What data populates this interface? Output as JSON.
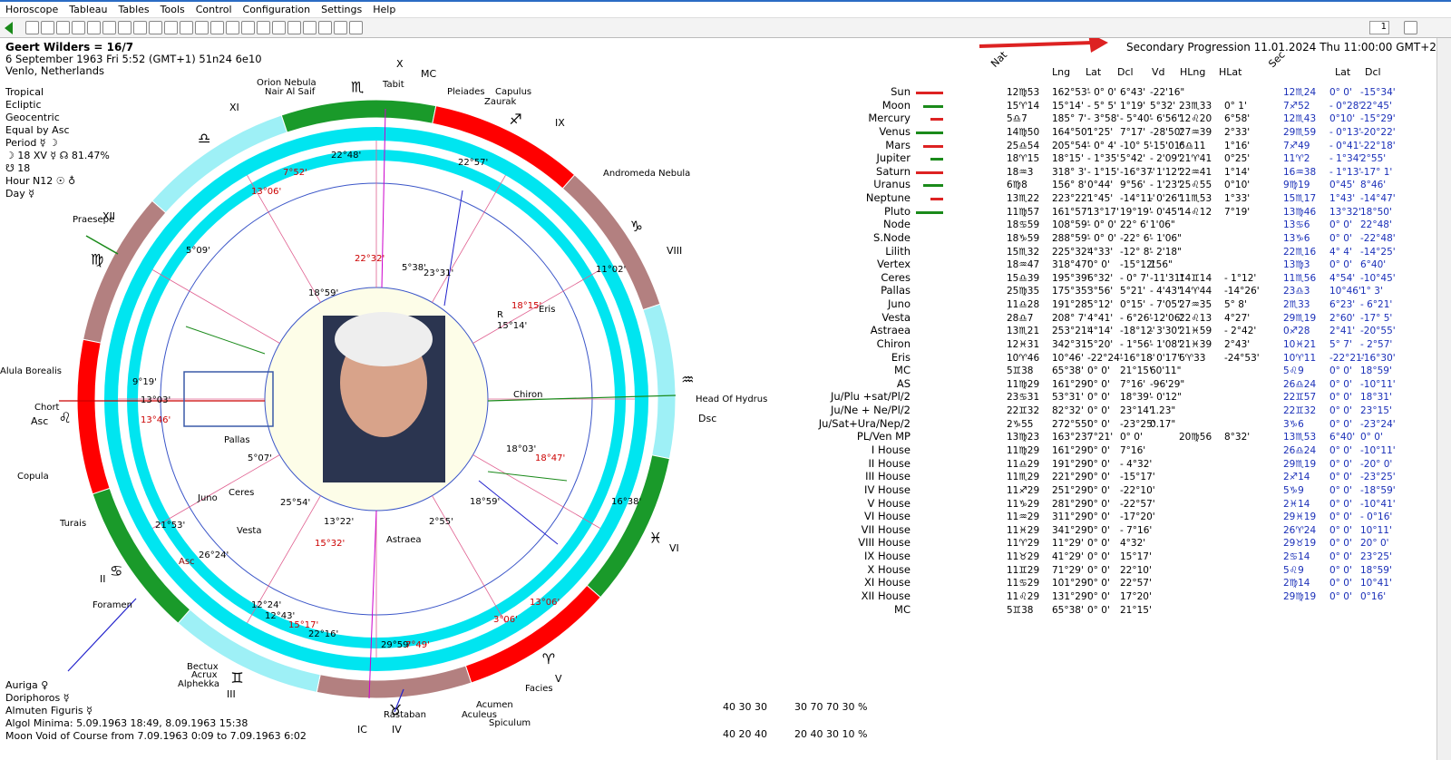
{
  "menu": [
    "Horoscope",
    "Tableau",
    "Tables",
    "Tools",
    "Control",
    "Configuration",
    "Settings",
    "Help"
  ],
  "toolbar": {
    "page_value": "1"
  },
  "header": {
    "name": "Geert Wilders = 16/7",
    "line2": "6 September 1963  Fri   5:52 (GMT+1) 51n24  6e10",
    "line3": "Venlo, Netherlands"
  },
  "settings": [
    "Tropical",
    "Ecliptic",
    "Geocentric",
    "Equal by Asc",
    "Period ☿ ☽",
    "☽  18 XV  ☿ ☊ 81.47%",
    "☋  18",
    "Hour N12 ☉ ♁",
    "Day ☿"
  ],
  "progression_title": "Secondary Progression 11.01.2024  Thu 11:00:00 GMT+2",
  "bottom_left": [
    "Auriga  ♀",
    "Doriphoros  ☿",
    "Almuten Figuris  ☿",
    "Algol Minima: 5.09.1963 18:49,  8.09.1963 15:38",
    "Moon Void of Course from 7.09.1963  0:09 to 7.09.1963  6:02"
  ],
  "stats": {
    "row1": "40  30  30",
    "row2": "30  70  70  30 %",
    "row3": "40  20  40",
    "row4": "20  40  30  10 %"
  },
  "columns": {
    "nat": "Nat",
    "lng": "Lng",
    "lat": "Lat",
    "dcl": "Dcl",
    "vd": "Vd",
    "hlng": "HLng",
    "hlat": "HLat",
    "sec": "Sec",
    "slat": "Lat",
    "sdcl": "Dcl"
  },
  "planets": [
    {
      "n": "Sun",
      "pos": "12♍53",
      "lng": "162°53'",
      "lat": "- 0° 0'",
      "dcl": "6°43'",
      "vd": "-22'16\"",
      "hl": "",
      "hla": "",
      "sp": "12♏24",
      "sl": "0° 0'",
      "sd": "-15°34'"
    },
    {
      "n": "Moon",
      "pos": "15♈14",
      "lng": "15°14'",
      "lat": "- 5° 5'",
      "dcl": "1°19'",
      "vd": "5°32'",
      "hl": "23♏33",
      "hla": "0° 1'",
      "sp": "7♐52",
      "sl": "- 0°28'",
      "sd": "22°45'"
    },
    {
      "n": "Mercury",
      "pos": "5♎7",
      "lng": "185° 7'",
      "lat": "- 3°58'",
      "dcl": "- 5°40'",
      "vd": "- 6'56\"",
      "hl": "12♌20",
      "hla": "6°58'",
      "sp": "12♏43",
      "sl": "0°10'",
      "sd": "-15°29'"
    },
    {
      "n": "Venus",
      "pos": "14♍50",
      "lng": "164°50'",
      "lat": "1°25'",
      "dcl": "7°17'",
      "vd": "-28'50\"",
      "hl": "27♒39",
      "hla": "2°33'",
      "sp": "29♏59",
      "sl": "- 0°13'",
      "sd": "-20°22'"
    },
    {
      "n": "Mars",
      "pos": "25♎54",
      "lng": "205°54'",
      "lat": "- 0° 4'",
      "dcl": "-10° 5'",
      "vd": "-15'01\"",
      "hl": "6♎11",
      "hla": "1°16'",
      "sp": "7♐49",
      "sl": "- 0°41'",
      "sd": "-22°18'"
    },
    {
      "n": "Jupiter",
      "pos": "18♈15",
      "lng": "18°15'",
      "lat": "- 1°35'",
      "dcl": "5°42'",
      "vd": "- 2'09\"",
      "hl": "21♈41",
      "hla": "0°25'",
      "sp": "11♈2",
      "sl": "- 1°34'",
      "sd": "2°55'"
    },
    {
      "n": "Saturn",
      "pos": "18♒3",
      "lng": "318° 3'",
      "lat": "- 1°15'",
      "dcl": "-16°37'",
      "vd": "- 1'12\"",
      "hl": "22♒41",
      "hla": "1°14'",
      "sp": "16♒38",
      "sl": "- 1°13'",
      "sd": "-17° 1'"
    },
    {
      "n": "Uranus",
      "pos": "6♍8",
      "lng": "156° 8'",
      "lat": "0°44'",
      "dcl": "9°56'",
      "vd": "- 1'23\"",
      "hl": "25♌55",
      "hla": "0°10'",
      "sp": "9♍19",
      "sl": "0°45'",
      "sd": "8°46'"
    },
    {
      "n": "Neptune",
      "pos": "13♏22",
      "lng": "223°22'",
      "lat": "1°45'",
      "dcl": "-14°11'",
      "vd": "- 0'26\"",
      "hl": "11♏53",
      "hla": "1°33'",
      "sp": "15♏17",
      "sl": "1°43'",
      "sd": "-14°47'"
    },
    {
      "n": "Pluto",
      "pos": "11♍57",
      "lng": "161°57'",
      "lat": "13°17'",
      "dcl": "19°19'",
      "vd": "- 0'45\"",
      "hl": "14♌12",
      "hla": "7°19'",
      "sp": "13♍46",
      "sl": "13°32'",
      "sd": "18°50'"
    },
    {
      "n": "Node",
      "pos": "18♋59",
      "lng": "108°59'",
      "lat": "- 0° 0'",
      "dcl": "22° 6'",
      "vd": "1'06\"",
      "hl": "",
      "hla": "",
      "sp": "13♋6",
      "sl": "0° 0'",
      "sd": "22°48'"
    },
    {
      "n": "S.Node",
      "pos": "18♑59",
      "lng": "288°59'",
      "lat": "- 0° 0'",
      "dcl": "-22° 6'",
      "vd": "- 1'06\"",
      "hl": "",
      "hla": "",
      "sp": "13♑6",
      "sl": "0° 0'",
      "sd": "-22°48'"
    },
    {
      "n": "Lilith",
      "pos": "15♏32",
      "lng": "225°32'",
      "lat": "4°33'",
      "dcl": "-12° 8'",
      "vd": "- 2'18\"",
      "hl": "",
      "hla": "",
      "sp": "22♏16",
      "sl": "4° 4'",
      "sd": "-14°25'"
    },
    {
      "n": "Vertex",
      "pos": "18♒47",
      "lng": "318°47'",
      "lat": "0° 0'",
      "dcl": "-15°12'",
      "vd": "156\"",
      "hl": "",
      "hla": "",
      "sp": "13♍3",
      "sl": "0° 0'",
      "sd": "6°40'"
    },
    {
      "n": "Ceres",
      "pos": "15♎39",
      "lng": "195°39'",
      "lat": "6°32'",
      "dcl": "- 0° 7'",
      "vd": "-11'31\"",
      "hl": "14♊14",
      "hla": "- 1°12'",
      "sp": "11♏56",
      "sl": "4°54'",
      "sd": "-10°45'"
    },
    {
      "n": "Pallas",
      "pos": "25♍35",
      "lng": "175°35'",
      "lat": "3°56'",
      "dcl": "5°21'",
      "vd": "- 4'43\"",
      "hl": "14♈44",
      "hla": "-14°26'",
      "sp": "23♎3",
      "sl": "10°46'",
      "sd": "1° 3'"
    },
    {
      "n": "Juno",
      "pos": "11♎28",
      "lng": "191°28'",
      "lat": "5°12'",
      "dcl": "0°15'",
      "vd": "- 7'05\"",
      "hl": "27♒35",
      "hla": "5° 8'",
      "sp": "2♏33",
      "sl": "6°23'",
      "sd": "- 6°21'"
    },
    {
      "n": "Vesta",
      "pos": "28♎7",
      "lng": "208° 7'",
      "lat": "4°41'",
      "dcl": "- 6°26'",
      "vd": "-12'06\"",
      "hl": "22♌13",
      "hla": "4°27'",
      "sp": "29♏19",
      "sl": "2°60'",
      "sd": "-17° 5'"
    },
    {
      "n": "Astraea",
      "pos": "13♏21",
      "lng": "253°21'",
      "lat": "4°14'",
      "dcl": "-18°12'",
      "vd": "- 3'30\"",
      "hl": "21♓59",
      "hla": "- 2°42'",
      "sp": "0♐28",
      "sl": "2°41'",
      "sd": "-20°55'"
    },
    {
      "n": "Chiron",
      "pos": "12♓31",
      "lng": "342°31'",
      "lat": "5°20'",
      "dcl": "- 1°56'",
      "vd": "- 1'08\"",
      "hl": "21♓39",
      "hla": "2°43'",
      "sp": "10♓21",
      "sl": "5° 7'",
      "sd": "- 2°57'"
    },
    {
      "n": "Eris",
      "pos": "10♈46",
      "lng": "10°46'",
      "lat": "-22°24'",
      "dcl": "-16°18'",
      "vd": "- 0'17\"",
      "hl": "6♈33",
      "hla": "-24°53'",
      "sp": "10♈11",
      "sl": "-22°21'",
      "sd": "-16°30'"
    },
    {
      "n": "MC",
      "pos": "5♊38",
      "lng": "65°38'",
      "lat": "0° 0'",
      "dcl": "21°15'",
      "vd": "60'11\"",
      "hl": "",
      "hla": "",
      "sp": "5♌9",
      "sl": "0° 0'",
      "sd": "18°59'"
    },
    {
      "n": "AS",
      "pos": "11♍29",
      "lng": "161°29'",
      "lat": "0° 0'",
      "dcl": "7°16'",
      "vd": "-96'29\"",
      "hl": "",
      "hla": "",
      "sp": "26♎24",
      "sl": "0° 0'",
      "sd": "-10°11'"
    },
    {
      "n": "Ju/Plu +sat/Pl/2",
      "pos": "23♋31",
      "lng": "53°31'",
      "lat": "0° 0'",
      "dcl": "18°39'",
      "vd": "- 0'12\"",
      "hl": "",
      "hla": "",
      "sp": "22♊57",
      "sl": "0° 0'",
      "sd": "18°31'"
    },
    {
      "n": "Ju/Ne + Ne/Pl/2",
      "pos": "22♊32",
      "lng": "82°32'",
      "lat": "0° 0'",
      "dcl": "23°14'",
      "vd": "1.23\"",
      "hl": "",
      "hla": "",
      "sp": "22♊32",
      "sl": "0° 0'",
      "sd": "23°15'"
    },
    {
      "n": "Ju/Sat+Ura/Nep/2",
      "pos": "2♑55",
      "lng": "272°55'",
      "lat": "0° 0'",
      "dcl": "-23°25'",
      "vd": "0.17\"",
      "hl": "",
      "hla": "",
      "sp": "3♑6",
      "sl": "0° 0'",
      "sd": "-23°24'"
    },
    {
      "n": "PL/Ven MP",
      "pos": "13♍23",
      "lng": "163°23'",
      "lat": "7°21'",
      "dcl": "0° 0'",
      "vd": "",
      "hl": "20♍56",
      "hla": "8°32'",
      "sp": "13♏53",
      "sl": "6°40'",
      "sd": "0° 0'"
    },
    {
      "n": "I House",
      "pos": "11♍29",
      "lng": "161°29'",
      "lat": "0° 0'",
      "dcl": "7°16'",
      "vd": "",
      "hl": "",
      "hla": "",
      "sp": "26♎24",
      "sl": "0° 0'",
      "sd": "-10°11'"
    },
    {
      "n": "II House",
      "pos": "11♎29",
      "lng": "191°29'",
      "lat": "0° 0'",
      "dcl": "- 4°32'",
      "vd": "",
      "hl": "",
      "hla": "",
      "sp": "29♏19",
      "sl": "0° 0'",
      "sd": "-20° 0'"
    },
    {
      "n": "III House",
      "pos": "11♏29",
      "lng": "221°29'",
      "lat": "0° 0'",
      "dcl": "-15°17'",
      "vd": "",
      "hl": "",
      "hla": "",
      "sp": "2♐14",
      "sl": "0° 0'",
      "sd": "-23°25'"
    },
    {
      "n": "IV House",
      "pos": "11♐29",
      "lng": "251°29'",
      "lat": "0° 0'",
      "dcl": "-22°10'",
      "vd": "",
      "hl": "",
      "hla": "",
      "sp": "5♑9",
      "sl": "0° 0'",
      "sd": "-18°59'"
    },
    {
      "n": "V House",
      "pos": "11♑29",
      "lng": "281°29'",
      "lat": "0° 0'",
      "dcl": "-22°57'",
      "vd": "",
      "hl": "",
      "hla": "",
      "sp": "2♓14",
      "sl": "0° 0'",
      "sd": "-10°41'"
    },
    {
      "n": "VI House",
      "pos": "11♒29",
      "lng": "311°29'",
      "lat": "0° 0'",
      "dcl": "-17°20'",
      "vd": "",
      "hl": "",
      "hla": "",
      "sp": "29♓19",
      "sl": "0° 0'",
      "sd": "- 0°16'"
    },
    {
      "n": "VII House",
      "pos": "11♓29",
      "lng": "341°29'",
      "lat": "0° 0'",
      "dcl": "- 7°16'",
      "vd": "",
      "hl": "",
      "hla": "",
      "sp": "26♈24",
      "sl": "0° 0'",
      "sd": "10°11'"
    },
    {
      "n": "VIII House",
      "pos": "11♈29",
      "lng": "11°29'",
      "lat": "0° 0'",
      "dcl": "4°32'",
      "vd": "",
      "hl": "",
      "hla": "",
      "sp": "29♉19",
      "sl": "0° 0'",
      "sd": "20° 0'"
    },
    {
      "n": "IX House",
      "pos": "11♉29",
      "lng": "41°29'",
      "lat": "0° 0'",
      "dcl": "15°17'",
      "vd": "",
      "hl": "",
      "hla": "",
      "sp": "2♋14",
      "sl": "0° 0'",
      "sd": "23°25'"
    },
    {
      "n": "X House",
      "pos": "11♊29",
      "lng": "71°29'",
      "lat": "0° 0'",
      "dcl": "22°10'",
      "vd": "",
      "hl": "",
      "hla": "",
      "sp": "5♌9",
      "sl": "0° 0'",
      "sd": "18°59'"
    },
    {
      "n": "XI House",
      "pos": "11♋29",
      "lng": "101°29'",
      "lat": "0° 0'",
      "dcl": "22°57'",
      "vd": "",
      "hl": "",
      "hla": "",
      "sp": "2♍14",
      "sl": "0° 0'",
      "sd": "10°41'"
    },
    {
      "n": "XII House",
      "pos": "11♌29",
      "lng": "131°29'",
      "lat": "0° 0'",
      "dcl": "17°20'",
      "vd": "",
      "hl": "",
      "hla": "",
      "sp": "29♍19",
      "sl": "0° 0'",
      "sd": "0°16'"
    },
    {
      "n": "MC",
      "pos": "5♊38",
      "lng": "65°38'",
      "lat": "0° 0'",
      "dcl": "21°15'",
      "vd": "",
      "hl": "",
      "hla": "",
      "sp": "",
      "sl": "",
      "sd": ""
    }
  ],
  "chart_labels": {
    "houses": [
      "X",
      "XI",
      "XII",
      "Asc",
      "II",
      "III",
      "IC",
      "IV",
      "V",
      "VI",
      "Dsc",
      "VIII",
      "IX",
      "MC"
    ],
    "stars": [
      "Orion Nebula",
      "Nair Al Saif",
      "Tabit",
      "Pleiades",
      "Zaurak",
      "Capulus",
      "Andromeda Nebula",
      "Praesepe",
      "Alula Borealis",
      "Copula",
      "Turais",
      "Foramen",
      "Bectux",
      "Acrux",
      "Alphekka",
      "Facies",
      "Acumen",
      "Aculeus",
      "Spiculum",
      "Rastaban",
      "Head Of Hydrus",
      "Chort"
    ],
    "outer_degrees": [
      "7°52'",
      "22°48'",
      "22°57'",
      "13°06'",
      "5°09'",
      "11°02'",
      "3°06'",
      "12°24'",
      "12°43'",
      "15°17'",
      "22°16'",
      "29°59'",
      "7°49'",
      "26°24'",
      "16°38'",
      "13°06'"
    ],
    "inner_degrees": [
      "22°32'",
      "5°38'",
      "23°31'",
      "18°59'",
      "18°15'",
      "15°14'",
      "9°19'",
      "13°03'",
      "13°46'",
      "5°07'",
      "25°54'",
      "13°22'",
      "15°32'",
      "18°59'",
      "2°55'",
      "18°03'",
      "18°47'",
      "21°53'"
    ],
    "small_labels": [
      "Eris",
      "Chiron",
      "Pallas",
      "Juno",
      "Ceres",
      "Vesta",
      "Astraea",
      "R",
      "Asc"
    ]
  }
}
